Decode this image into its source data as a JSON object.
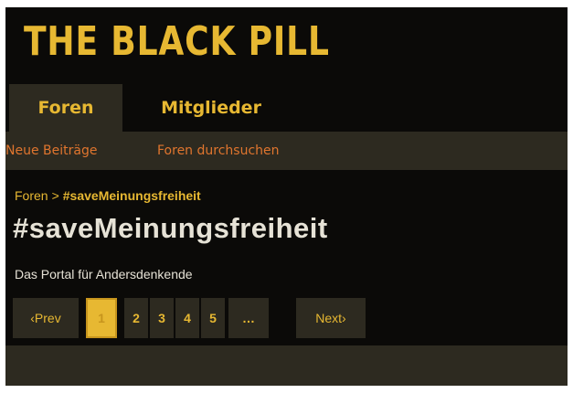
{
  "site": {
    "logo_text": "THE BLACK PILL"
  },
  "tabs": [
    {
      "label": "Foren",
      "active": true
    },
    {
      "label": "Mitglieder",
      "active": false
    }
  ],
  "subnav": [
    {
      "label": "Neue Beiträge"
    },
    {
      "label": "Foren durchsuchen"
    }
  ],
  "breadcrumb": {
    "root": "Foren",
    "separator": ">",
    "current": "#saveMeinungsfreiheit"
  },
  "page": {
    "title": "#saveMeinungsfreiheit",
    "description": "Das Portal für Andersdenkende"
  },
  "pagination": {
    "prev_label": "‹Prev",
    "next_label": "Next›",
    "pages": [
      "1",
      "2",
      "3",
      "4",
      "5"
    ],
    "ellipsis": "…",
    "current_page": "1"
  },
  "colors": {
    "background": "#0b0a08",
    "panel": "#2d2a20",
    "accent_gold": "#e7b832",
    "accent_orange": "#e0752e",
    "text_light": "#e6e2d6"
  }
}
